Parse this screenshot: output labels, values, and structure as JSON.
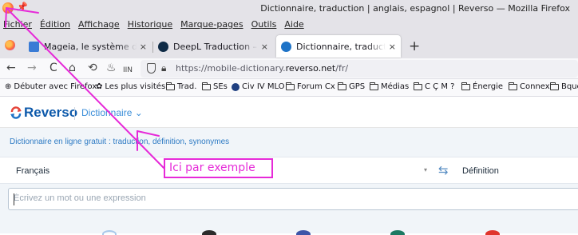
{
  "window": {
    "title": "Dictionnaire, traduction | anglais, espagnol | Reverso — Mozilla Firefox"
  },
  "menu": [
    "Fichier",
    "Édition",
    "Affichage",
    "Historique",
    "Marque-pages",
    "Outils",
    "Aide"
  ],
  "tabs": [
    {
      "title": "Mageia, le système d'exploi",
      "close": "×",
      "favicon_color": "#3a7bd5"
    },
    {
      "title": "DeepL Traduction – DeepL",
      "close": "×",
      "favicon_color": "#0f2b46"
    },
    {
      "title": "Dictionnaire, traduction | an",
      "close": "×",
      "favicon_color": "#1e73c7",
      "active": true
    }
  ],
  "new_tab": "+",
  "nav": {
    "back": "←",
    "forward": "→",
    "reload": "C",
    "home": "⌂",
    "history": "⟲",
    "extensions": "♨",
    "library": "IIN",
    "url_prefix": "https://mobile-dictionary.",
    "url_domain": "reverso.net",
    "url_suffix": "/fr/"
  },
  "bookmarks": [
    {
      "label": "Débuter avec Firefox",
      "icon": "firefox-icon"
    },
    {
      "label": "Les plus visités",
      "icon": "gear-icon"
    },
    {
      "label": "Trad.",
      "icon": "folder-icon"
    },
    {
      "label": "SEs",
      "icon": "folder-icon"
    },
    {
      "label": "Civ IV MLO",
      "icon": "site-icon"
    },
    {
      "label": "Forum Cx",
      "icon": "folder-icon"
    },
    {
      "label": "GPS",
      "icon": "folder-icon"
    },
    {
      "label": "Médias",
      "icon": "folder-icon"
    },
    {
      "label": "C Ç M ?",
      "icon": "folder-icon"
    },
    {
      "label": "Énergie",
      "icon": "folder-icon"
    },
    {
      "label": "Connex",
      "icon": "folder-icon"
    },
    {
      "label": "Bques",
      "icon": "folder-icon"
    }
  ],
  "page": {
    "logo": "Reverso",
    "section": "Dictionnaire",
    "section_caret": "⌄",
    "tagline": "Dictionnaire en ligne gratuit : traduction, définition, synonymes",
    "source_language": "Français",
    "caret": "▾",
    "swap": "⇆",
    "target_mode": "Définition",
    "search_placeholder": "Écrivez un mot ou une expression",
    "search_value": ""
  },
  "annotation": {
    "text": "Ici par exemple",
    "color": "#e62ad8"
  },
  "colors": {
    "brand": "#0e5aab",
    "accent": "#3d8fd9",
    "chrome": "#e4e3e8"
  }
}
